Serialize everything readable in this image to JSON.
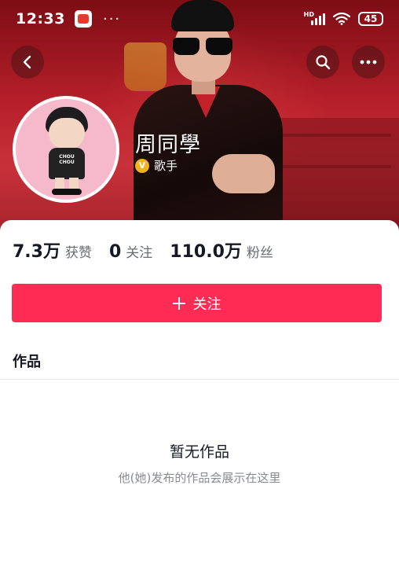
{
  "status_bar": {
    "time": "12:33",
    "dots": "···",
    "network_label": "HD",
    "battery": "45"
  },
  "nav": {
    "back_icon": "chevron-left-icon",
    "search_icon": "search-icon",
    "more_icon": "more-horizontal-icon"
  },
  "profile": {
    "name": "周同學",
    "verification_tag": "歌手",
    "verification_badge": "V",
    "avatar_shirt_text": "CHOU CHOU"
  },
  "stats": [
    {
      "value": "7.3万",
      "label": "获赞"
    },
    {
      "value": "0",
      "label": "关注"
    },
    {
      "value": "110.0万",
      "label": "粉丝"
    }
  ],
  "follow_button": {
    "label": "关注"
  },
  "works": {
    "title": "作品",
    "empty_title": "暂无作品",
    "empty_subtitle": "他(她)发布的作品会展示在这里"
  },
  "colors": {
    "accent": "#fe2c55",
    "banner": "#b8202b",
    "avatar_bg": "#f6b9cc",
    "badge": "#f1b31c"
  }
}
